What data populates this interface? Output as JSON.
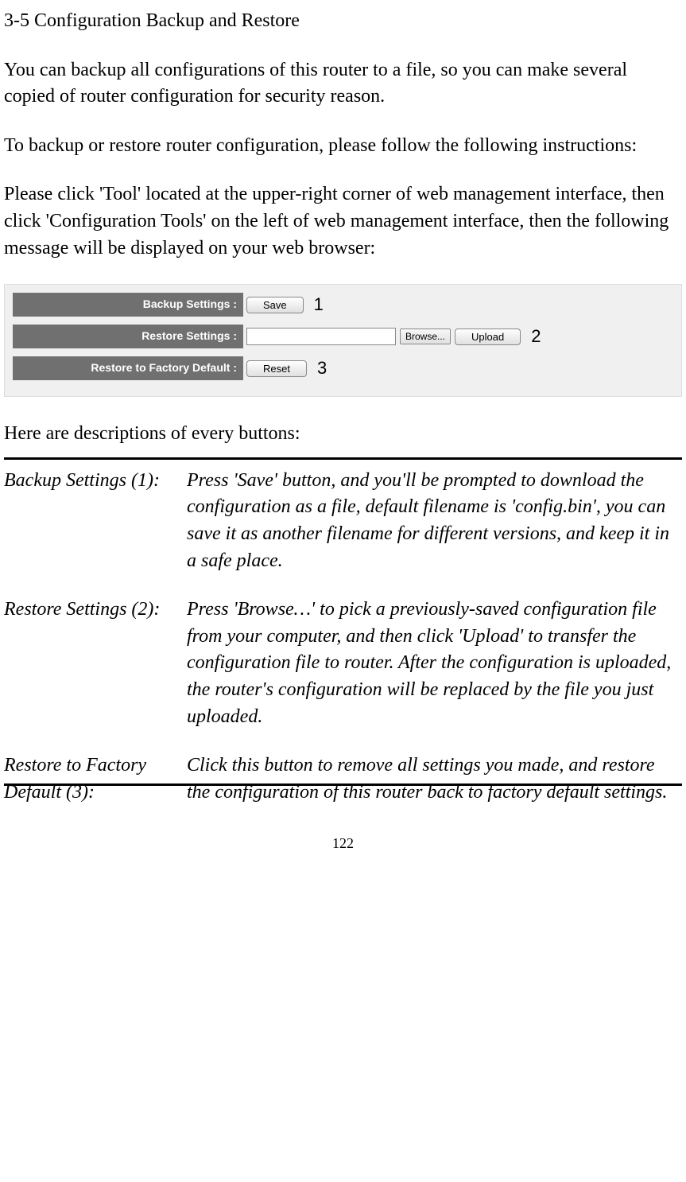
{
  "section_title": "3-5 Configuration Backup and Restore",
  "para1": "You can backup all configurations of this router to a file, so you can make several copied of router configuration for security reason.",
  "para2": "To backup or restore router configuration, please follow the following instructions:",
  "para3": "Please click 'Tool' located at the upper-right corner of web management interface, then click 'Configuration Tools' on the left of web management interface, then the following message will be displayed on your web browser:",
  "ui": {
    "backup_label": "Backup Settings :",
    "restore_label": "Restore Settings :",
    "factory_label": "Restore to Factory Default :",
    "save_btn": "Save",
    "browse_btn": "Browse...",
    "upload_btn": "Upload",
    "reset_btn": "Reset",
    "callout1": "1",
    "callout2": "2",
    "callout3": "3"
  },
  "desc_intro": "Here are descriptions of every buttons:",
  "descriptions": [
    {
      "label": "Backup Settings (1):",
      "value": "Press 'Save' button, and you'll be prompted to download the configuration as a file, default filename is 'config.bin', you can save it as another filename for different versions, and keep it in a safe place."
    },
    {
      "label": "Restore Settings (2):",
      "value": "Press 'Browse…' to pick a previously-saved configuration file from your computer, and then click 'Upload' to transfer the configuration file to router. After the configuration is uploaded, the router's configuration will be replaced by the file you just uploaded."
    },
    {
      "label": "Restore to Factory Default (3):",
      "value": "Click this button to remove all settings you made, and restore the configuration of this router back to factory default settings."
    }
  ],
  "page_number": "122"
}
